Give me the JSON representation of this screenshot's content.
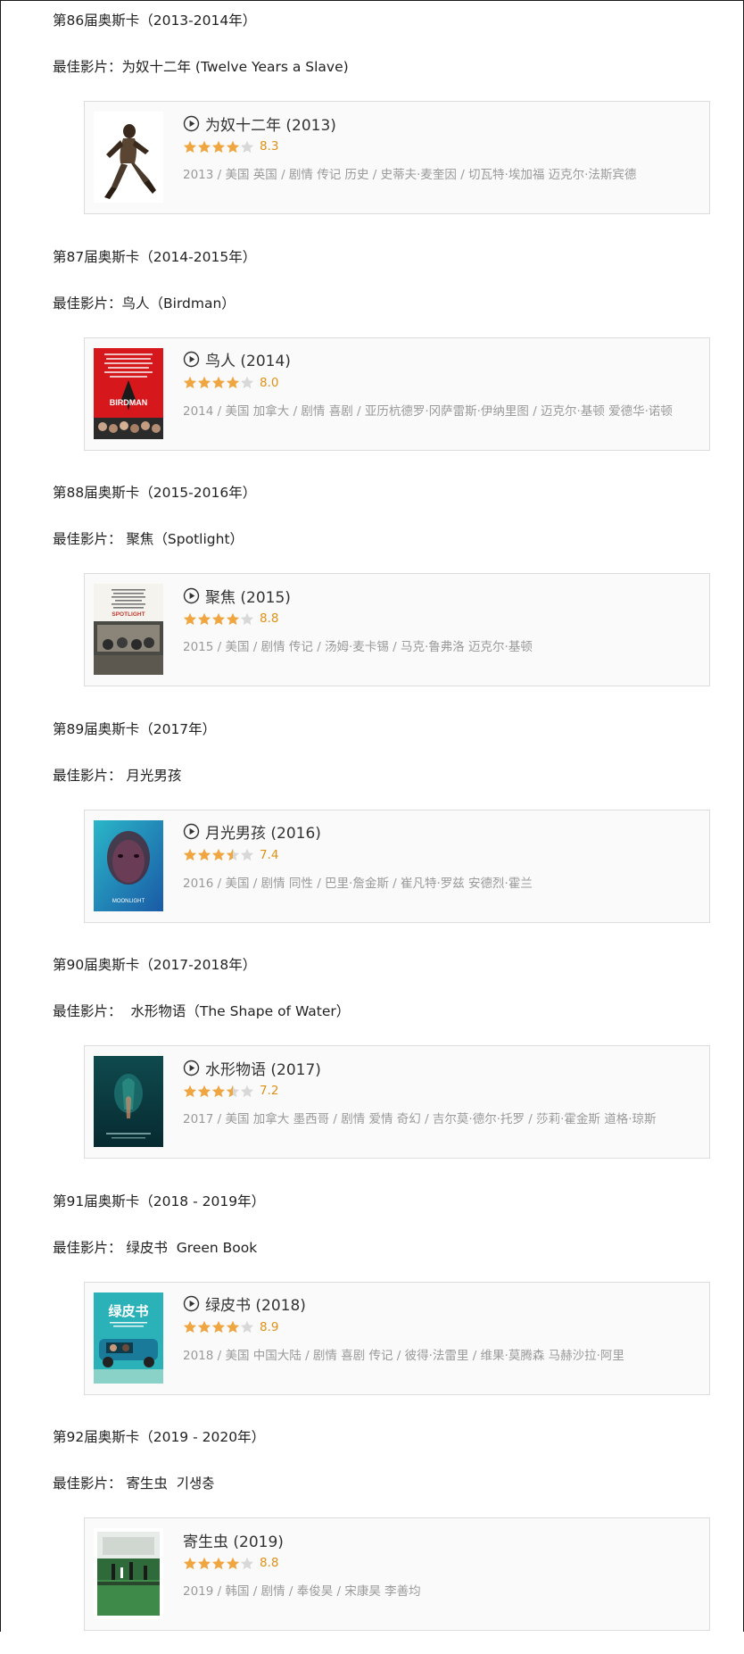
{
  "colors": {
    "star_full": "#f0a640",
    "star_empty": "#d8d8d8",
    "score": "#e09015",
    "meta": "#9a9a9a"
  },
  "sections": [
    {
      "award": "第86届奥斯卡（2013-2014年）",
      "best_film": "最佳影片：为奴十二年 (Twelve Years a Slave)",
      "movie": {
        "title": "为奴十二年 (2013)",
        "rating_stars": 4,
        "score": "8.3",
        "meta": "2013 / 美国 英国 / 剧情 传记 历史 / 史蒂夫·麦奎因 / 切瓦特·埃加福 迈克尔·法斯宾德",
        "poster": "twelve-years-a-slave-poster",
        "has_play": true
      }
    },
    {
      "award": "第87届奥斯卡（2014-2015年）",
      "best_film": "最佳影片：鸟人（Birdman）",
      "movie": {
        "title": "鸟人 (2014)",
        "rating_stars": 4,
        "score": "8.0",
        "meta": "2014 / 美国 加拿大 / 剧情 喜剧 / 亚历杭德罗·冈萨雷斯·伊纳里图 / 迈克尔·基顿 爱德华·诺顿",
        "poster": "birdman-poster",
        "has_play": true
      }
    },
    {
      "award": "第88届奥斯卡（2015-2016年）",
      "best_film": "最佳影片： 聚焦（Spotlight）",
      "movie": {
        "title": "聚焦 (2015)",
        "rating_stars": 4,
        "score": "8.8",
        "meta": "2015 / 美国 / 剧情 传记 / 汤姆·麦卡锡 / 马克·鲁弗洛 迈克尔·基顿",
        "poster": "spotlight-poster",
        "has_play": true
      }
    },
    {
      "award": "第89届奥斯卡（2017年）",
      "best_film": "最佳影片： 月光男孩",
      "movie": {
        "title": "月光男孩 (2016)",
        "rating_stars": 3.5,
        "score": "7.4",
        "meta": "2016 / 美国 / 剧情 同性 / 巴里·詹金斯 / 崔凡特·罗兹 安德烈·霍兰",
        "poster": "moonlight-poster",
        "has_play": true
      }
    },
    {
      "award": "第90届奥斯卡（2017-2018年）",
      "best_film": "最佳影片：  水形物语（The Shape of Water）",
      "movie": {
        "title": "水形物语 (2017)",
        "rating_stars": 3.5,
        "score": "7.2",
        "meta": "2017 / 美国 加拿大 墨西哥 / 剧情 爱情 奇幻 / 吉尔莫·德尔·托罗 / 莎莉·霍金斯 道格·琼斯",
        "poster": "shape-of-water-poster",
        "has_play": true
      }
    },
    {
      "award": "第91届奥斯卡（2018 - 2019年）",
      "best_film": "最佳影片： 绿皮书  Green Book",
      "movie": {
        "title": "绿皮书 (2018)",
        "rating_stars": 4,
        "score": "8.9",
        "meta": "2018 / 美国 中国大陆 / 剧情 喜剧 传记 / 彼得·法雷里 / 维果·莫腾森 马赫沙拉·阿里",
        "poster": "green-book-poster",
        "has_play": true
      }
    },
    {
      "award": "第92届奥斯卡（2019 - 2020年）",
      "best_film": "最佳影片： 寄生虫  기생충",
      "movie": {
        "title": "寄生虫 (2019)",
        "rating_stars": 4,
        "score": "8.8",
        "meta": "2019 / 韩国 / 剧情 / 奉俊昊 / 宋康昊 李善均",
        "poster": "parasite-poster",
        "has_play": false
      }
    }
  ]
}
